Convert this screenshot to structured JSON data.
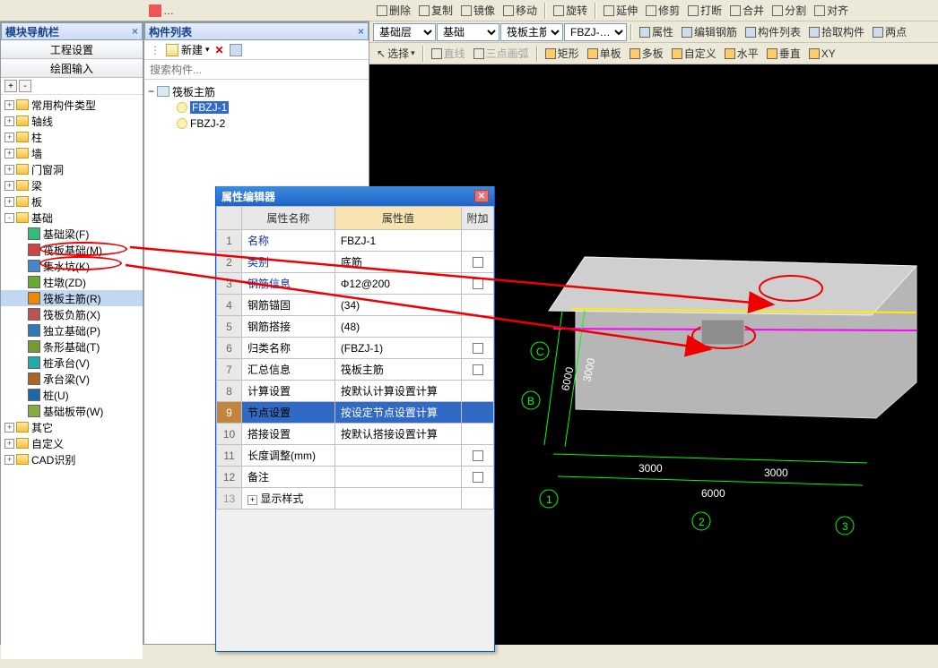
{
  "nav_panel": {
    "title": "模块导航栏",
    "tabs": [
      "工程设置",
      "绘图输入"
    ]
  },
  "tree_ctrl": {
    "expand": "+",
    "collapse": "-"
  },
  "tree": [
    {
      "label": "常用构件类型",
      "lvl": 0,
      "exp": "+"
    },
    {
      "label": "轴线",
      "lvl": 0,
      "exp": "+"
    },
    {
      "label": "柱",
      "lvl": 0,
      "exp": "+"
    },
    {
      "label": "墙",
      "lvl": 0,
      "exp": "+"
    },
    {
      "label": "门窗洞",
      "lvl": 0,
      "exp": "+"
    },
    {
      "label": "梁",
      "lvl": 0,
      "exp": "+"
    },
    {
      "label": "板",
      "lvl": 0,
      "exp": "+"
    },
    {
      "label": "基础",
      "lvl": 0,
      "exp": "-"
    },
    {
      "label": "基础梁(F)",
      "lvl": 1,
      "icon": "#3b7"
    },
    {
      "label": "筏板基础(M)",
      "lvl": 1,
      "icon": "#c44"
    },
    {
      "label": "集水坑(K)",
      "lvl": 1,
      "icon": "#48c"
    },
    {
      "label": "柱墩(ZD)",
      "lvl": 1,
      "icon": "#6a3"
    },
    {
      "label": "筏板主筋(R)",
      "lvl": 1,
      "icon": "#e80",
      "sel": true
    },
    {
      "label": "筏板负筋(X)",
      "lvl": 1,
      "icon": "#b55"
    },
    {
      "label": "独立基础(P)",
      "lvl": 1,
      "icon": "#37b"
    },
    {
      "label": "条形基础(T)",
      "lvl": 1,
      "icon": "#793"
    },
    {
      "label": "桩承台(V)",
      "lvl": 1,
      "icon": "#2aa"
    },
    {
      "label": "承台梁(V)",
      "lvl": 1,
      "icon": "#a62"
    },
    {
      "label": "桩(U)",
      "lvl": 1,
      "icon": "#26a"
    },
    {
      "label": "基础板带(W)",
      "lvl": 1,
      "icon": "#8a4"
    },
    {
      "label": "其它",
      "lvl": 0,
      "exp": "+"
    },
    {
      "label": "自定义",
      "lvl": 0,
      "exp": "+"
    },
    {
      "label": "CAD识别",
      "lvl": 0,
      "exp": "+"
    }
  ],
  "complist": {
    "title": "构件列表",
    "new": "新建",
    "search_ph": "搜索构件...",
    "root": "筏板主筋",
    "items": [
      "FBZJ-1",
      "FBZJ-2"
    ]
  },
  "vp_top": {
    "row0": [
      "删除",
      "复制",
      "镜像",
      "移动",
      "旋转",
      "延伸",
      "修剪",
      "打断",
      "合并",
      "分割",
      "对齐"
    ],
    "row1_dd": [
      "基础层",
      "基础",
      "筏板主筋",
      "FBZJ-…"
    ],
    "row1_btn": [
      "属性",
      "编辑钢筋",
      "构件列表",
      "拾取构件",
      "两点"
    ],
    "row2_left": "选择",
    "row2_mid": [
      "直线",
      "三点画弧"
    ],
    "row2_right": [
      "矩形",
      "单板",
      "多板",
      "自定义",
      "水平",
      "垂直",
      "XY"
    ]
  },
  "prop": {
    "title": "属性编辑器",
    "headers": [
      "",
      "属性名称",
      "属性值",
      "附加"
    ],
    "rows": [
      {
        "n": "1",
        "name": "名称",
        "val": "FBZJ-1",
        "blue": 1
      },
      {
        "n": "2",
        "name": "类别",
        "val": "底筋",
        "blue": 1,
        "chk": 1
      },
      {
        "n": "3",
        "name": "钢筋信息",
        "val": "Φ12@200",
        "blue": 1,
        "chk": 1
      },
      {
        "n": "4",
        "name": "钢筋锚固",
        "val": "(34)"
      },
      {
        "n": "5",
        "name": "钢筋搭接",
        "val": "(48)"
      },
      {
        "n": "6",
        "name": "归类名称",
        "val": "(FBZJ-1)",
        "chk": 1
      },
      {
        "n": "7",
        "name": "汇总信息",
        "val": "筏板主筋",
        "chk": 1
      },
      {
        "n": "8",
        "name": "计算设置",
        "val": "按默认计算设置计算"
      },
      {
        "n": "9",
        "name": "节点设置",
        "val": "按设定节点设置计算",
        "sel": 1
      },
      {
        "n": "10",
        "name": "搭接设置",
        "val": "按默认搭接设置计算"
      },
      {
        "n": "11",
        "name": "长度调整(mm)",
        "val": "",
        "chk": 1
      },
      {
        "n": "12",
        "name": "备注",
        "val": "",
        "chk": 1
      },
      {
        "n": "13",
        "name": "显示样式",
        "val": "",
        "dim": 1,
        "plus": 1
      }
    ]
  },
  "dims": {
    "h1": "3000",
    "h2": "3000",
    "h3": "6000",
    "v1": "6000",
    "v2": "3000",
    "a": "1",
    "b": "2",
    "c": "3",
    "cb": "B",
    "cc": "C"
  }
}
